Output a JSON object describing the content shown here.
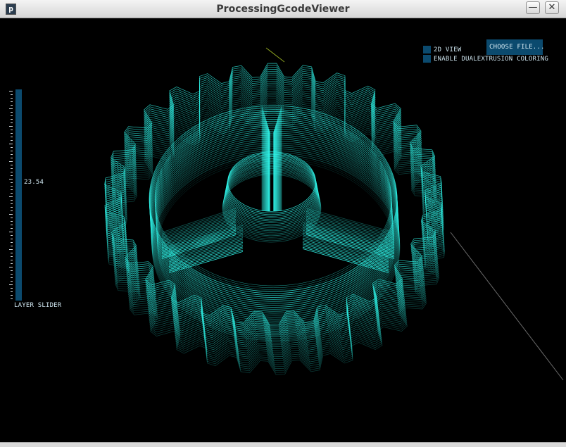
{
  "window": {
    "title": "ProcessingGcodeViewer",
    "app_icon_glyph": "p",
    "minimize_glyph": "—",
    "close_glyph": "✕"
  },
  "controls": {
    "layer_slider": {
      "label": "LAYER SLIDER",
      "value": "23.54"
    },
    "view_2d": {
      "label": "2D VIEW",
      "checked": false
    },
    "dual_extrusion": {
      "label": "ENABLE DUALEXTRUSION COLORING",
      "checked": false
    },
    "choose_file": {
      "label": "CHOOSE FILE..."
    }
  },
  "colors": {
    "background": "#000000",
    "toolpath": "#2ff2e6",
    "control_fill": "#0b4a6e",
    "axis_yellow": "#8aa020",
    "axis_gray": "#6a6a6a"
  },
  "icons": [
    "app-icon",
    "minimize-icon",
    "close-icon"
  ]
}
